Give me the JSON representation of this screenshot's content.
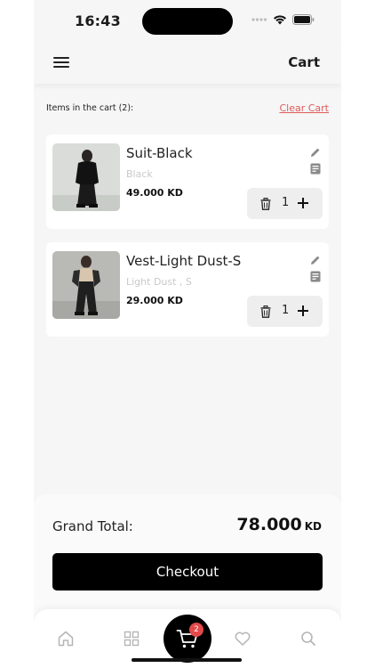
{
  "status_bar": {
    "time": "16:43",
    "icons": [
      "cellular-signal-icon",
      "wifi-icon",
      "battery-icon"
    ]
  },
  "header": {
    "title": "Cart",
    "menu_icon": "hamburger-menu-icon"
  },
  "cart": {
    "items_count_label": "Items in the cart (2):",
    "clear_label": "Clear Cart",
    "items": [
      {
        "name": "Suit-Black",
        "variant": "Black",
        "price": "49.000 KD",
        "quantity": "1"
      },
      {
        "name": "Vest-Light Dust-S",
        "variant": "Light Dust , S",
        "price": "29.000 KD",
        "quantity": "1"
      }
    ]
  },
  "summary": {
    "grand_total_label": "Grand Total:",
    "grand_total_value": "78.000",
    "currency": "KD",
    "checkout_label": "Checkout"
  },
  "tabbar": {
    "tabs": [
      "home-icon",
      "categories-icon",
      "cart-icon",
      "wishlist-icon",
      "search-icon"
    ],
    "active": "cart",
    "cart_badge": "2"
  },
  "colors": {
    "accent_red": "#e05a5a",
    "primary_button": "#000000",
    "background": "#f6f6f6"
  }
}
